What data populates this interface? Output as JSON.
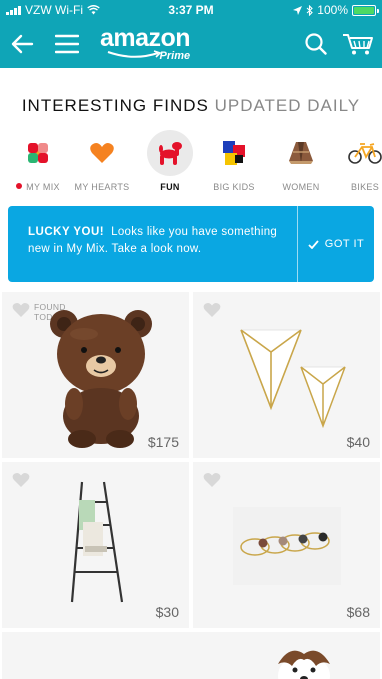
{
  "status": {
    "carrier": "VZW Wi-Fi",
    "time": "3:37 PM",
    "battery": "100%"
  },
  "nav": {
    "brand": "amazon",
    "sub": "Prime",
    "colors": {
      "header": "#0fa5b7",
      "banner": "#0aa7e2"
    }
  },
  "headline": {
    "part1": "INTERESTING FINDS",
    "part2": "UPDATED DAILY"
  },
  "categories": [
    {
      "label": "MY MIX",
      "icon": "mix-icon",
      "new_indicator": true
    },
    {
      "label": "MY HEARTS",
      "icon": "heart-icon"
    },
    {
      "label": "FUN",
      "icon": "balloon-dog-icon",
      "selected": true
    },
    {
      "label": "BIG KIDS",
      "icon": "cube-icon"
    },
    {
      "label": "WOMEN",
      "icon": "poncho-icon"
    },
    {
      "label": "BIKES",
      "icon": "bicycle-icon"
    }
  ],
  "banner": {
    "lead": "LUCKY YOU!",
    "text": "Looks like you have something new in My Mix. Take a look now.",
    "action": "GOT IT"
  },
  "products": [
    {
      "name": "bear-figure",
      "price": "$175",
      "badge_line1": "FOUND",
      "badge_line2": "TODAY"
    },
    {
      "name": "geometric-planters",
      "price": "$40"
    },
    {
      "name": "leaning-ladder-rack",
      "price": "$30"
    },
    {
      "name": "gemstone-rings",
      "price": "$68"
    },
    {
      "name": "dog-photo"
    }
  ]
}
